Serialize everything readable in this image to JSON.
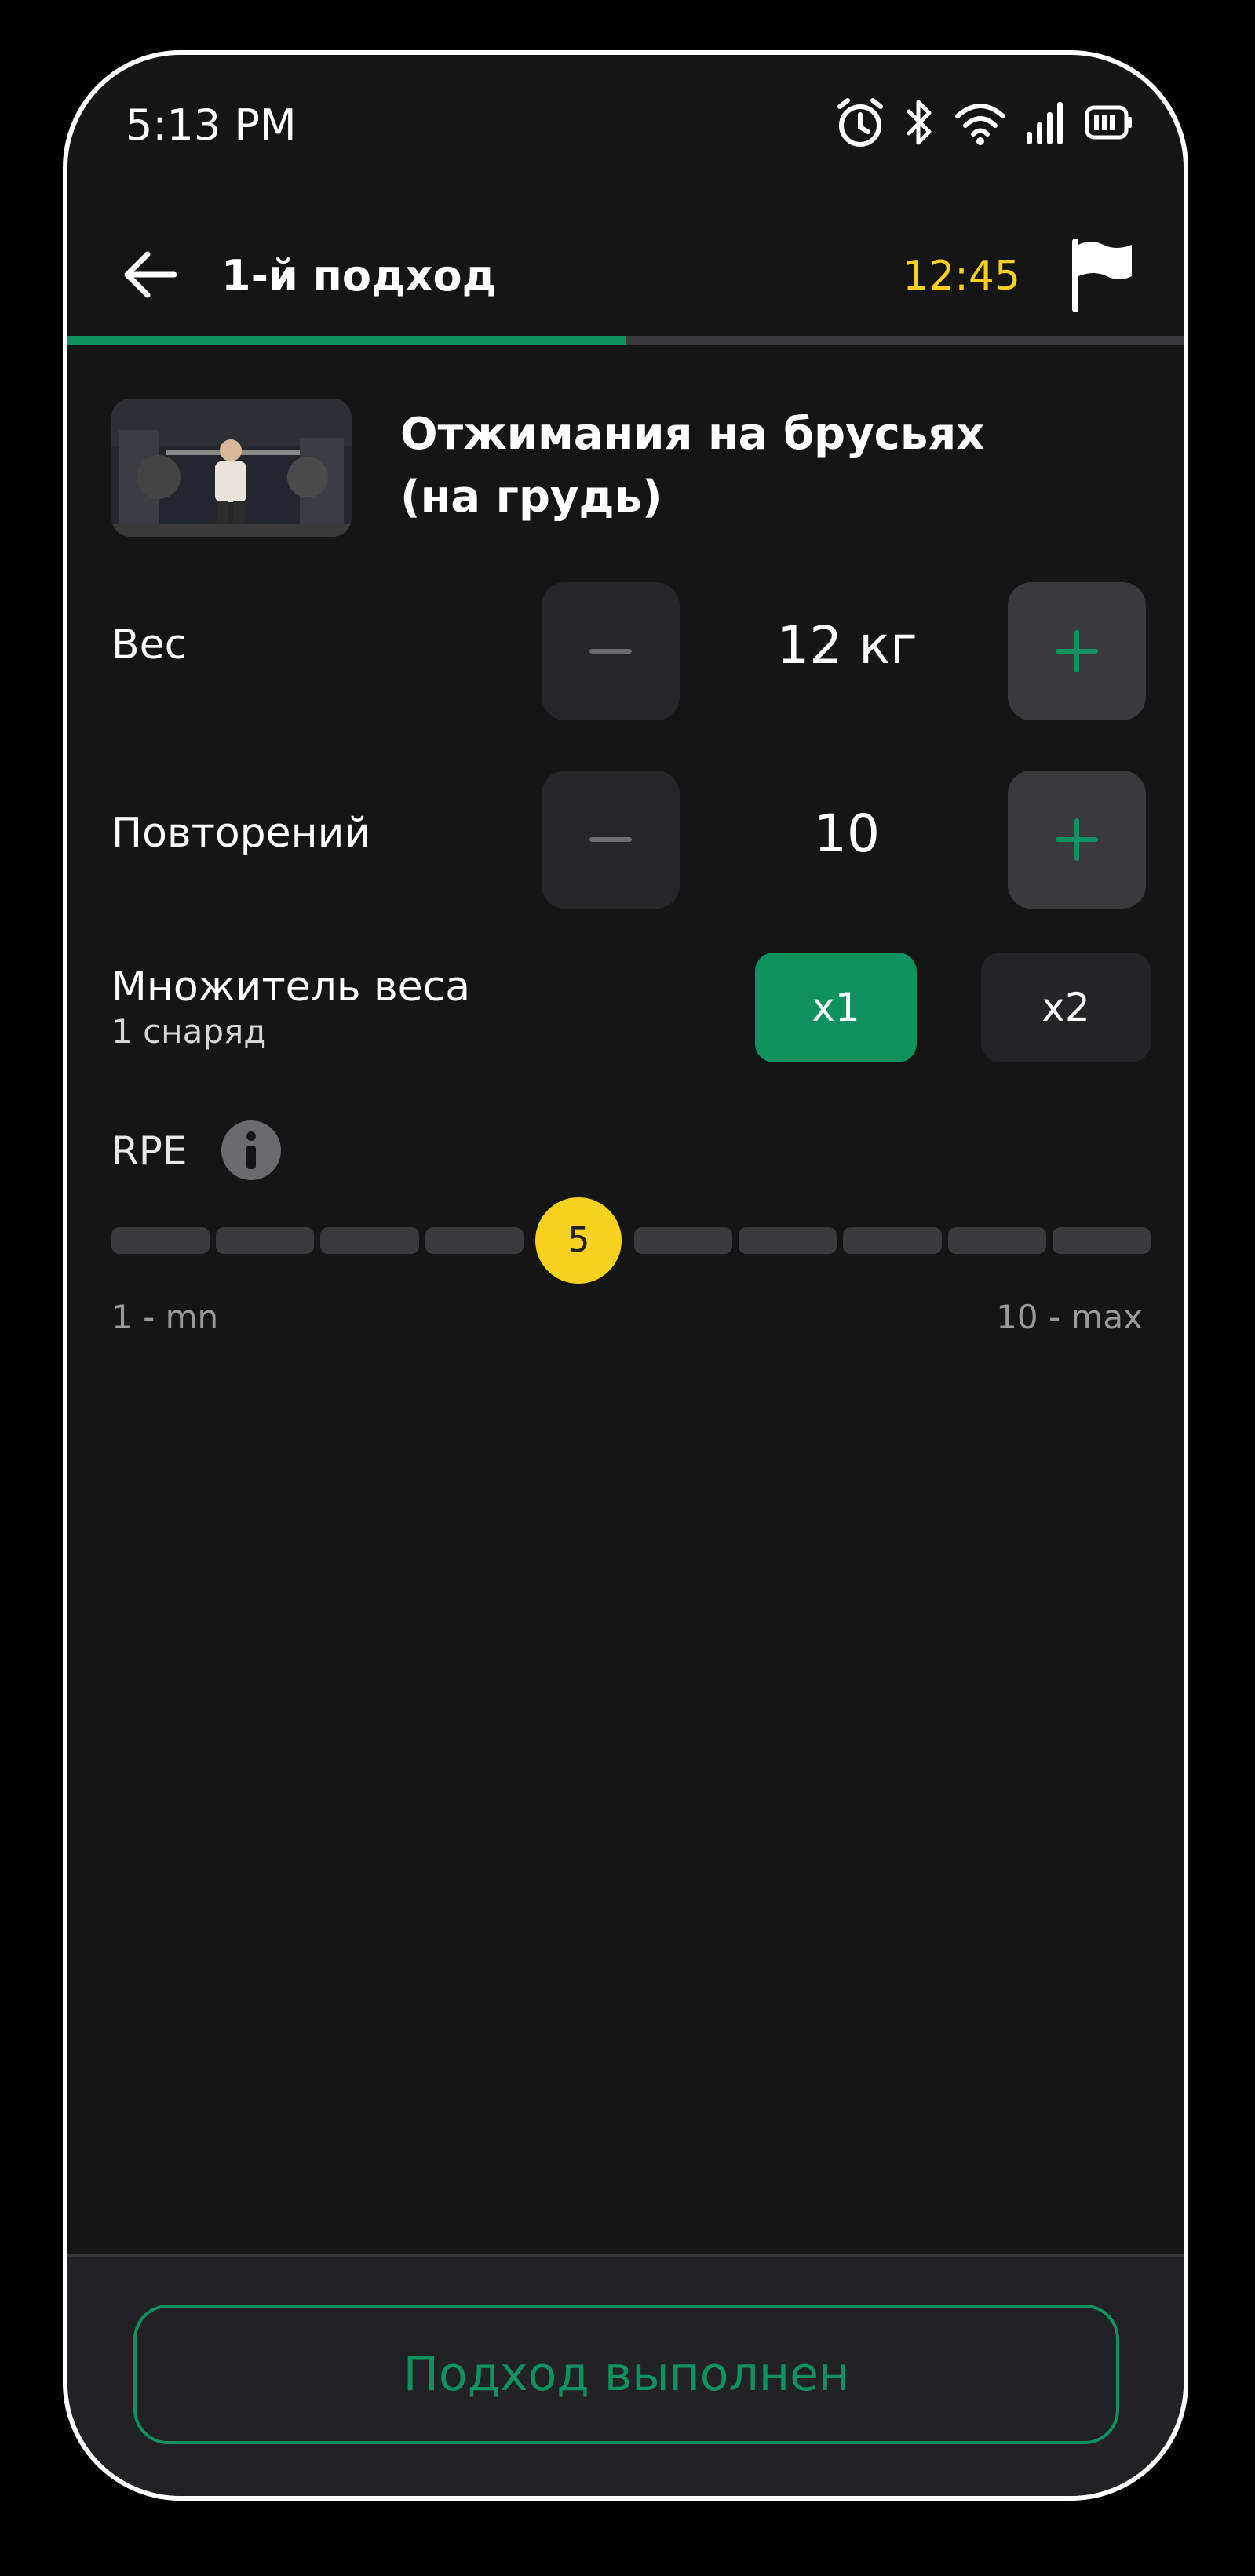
{
  "status_bar": {
    "time": "5:13 PM",
    "icons": [
      "alarm-icon",
      "bluetooth-icon",
      "wifi-icon",
      "signal-icon",
      "battery-icon"
    ]
  },
  "header": {
    "title": "1-й подход",
    "timer": "12:45"
  },
  "progress": {
    "fraction": 0.5
  },
  "exercise": {
    "name_line1": "Отжимания на брусьях",
    "name_line2": "(на грудь)"
  },
  "weight": {
    "label": "Вес",
    "value": "12 кг"
  },
  "reps": {
    "label": "Повторений",
    "value": "10"
  },
  "multiplier": {
    "label": "Множитель веса",
    "sublabel": "1 снаряд",
    "options": [
      "x1",
      "x2"
    ],
    "selected": "x1"
  },
  "rpe": {
    "label": "RPE",
    "value": "5",
    "segments": 10,
    "min_label": "1 - mn",
    "max_label": "10 - max"
  },
  "footer": {
    "done_label": "Подход выполнен"
  },
  "colors": {
    "accent": "#0f9160",
    "timer": "#f6d21e",
    "background": "#151515"
  }
}
